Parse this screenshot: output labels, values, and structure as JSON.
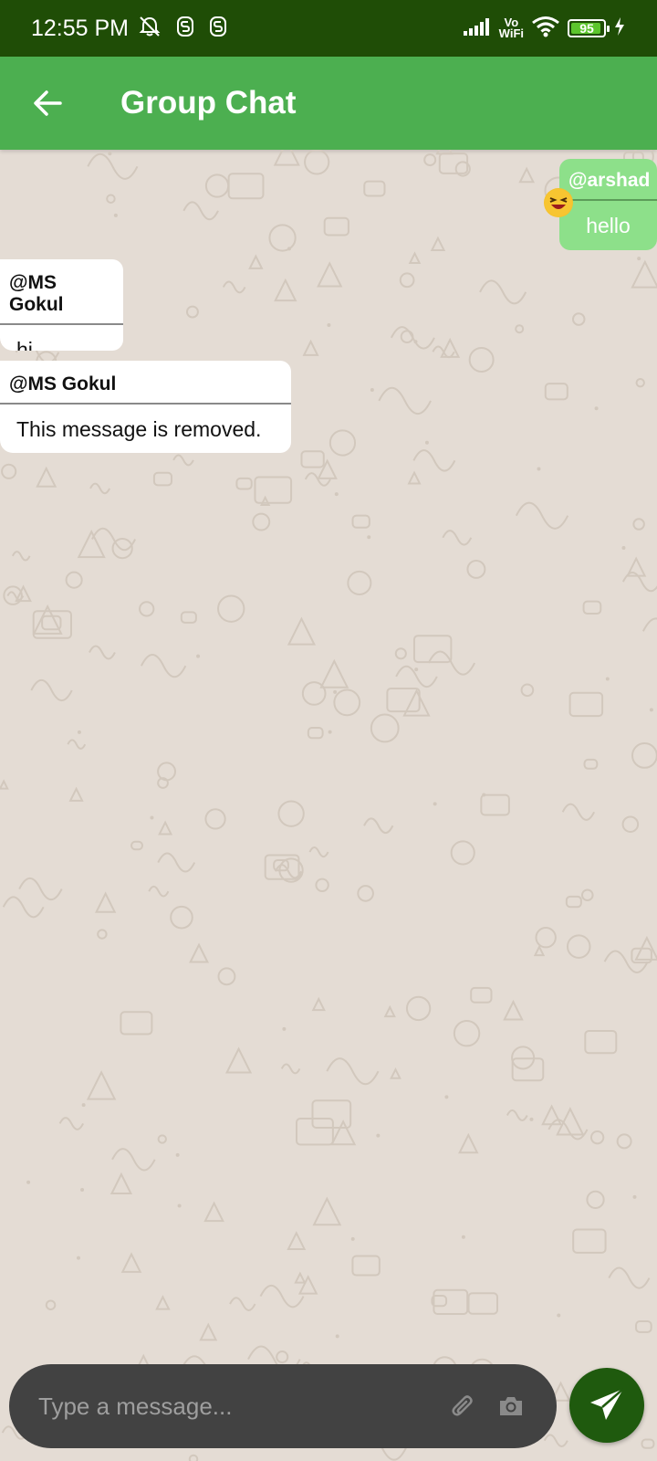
{
  "status_bar": {
    "time": "12:55 PM",
    "vowifi_top": "Vo",
    "vowifi_bottom": "WiFi",
    "battery_level": "95",
    "icons": [
      "alarm-off-icon",
      "s-app-icon",
      "s-app-icon",
      "signal-icon",
      "wifi-icon",
      "battery-icon",
      "charging-icon"
    ]
  },
  "app_bar": {
    "title": "Group Chat",
    "back_icon": "arrow-left-icon",
    "background": "#4caf50"
  },
  "messages": [
    {
      "sender": "@arshad",
      "text": "hello",
      "direction": "outgoing",
      "reaction": "laughing-emoji"
    },
    {
      "sender": "@MS Gokul",
      "text": "hi",
      "direction": "incoming"
    },
    {
      "sender": "@MS Gokul",
      "text": "This message is removed.",
      "direction": "incoming"
    }
  ],
  "composer": {
    "placeholder": "Type a message...",
    "attach_icon": "paperclip-icon",
    "camera_icon": "camera-icon",
    "send_icon": "send-icon"
  },
  "colors": {
    "status_bar": "#1f4d06",
    "outgoing_bubble": "#8de08a",
    "incoming_bubble": "#ffffff",
    "chat_background": "#e4dcd4",
    "send_button": "#1f5a0e"
  }
}
